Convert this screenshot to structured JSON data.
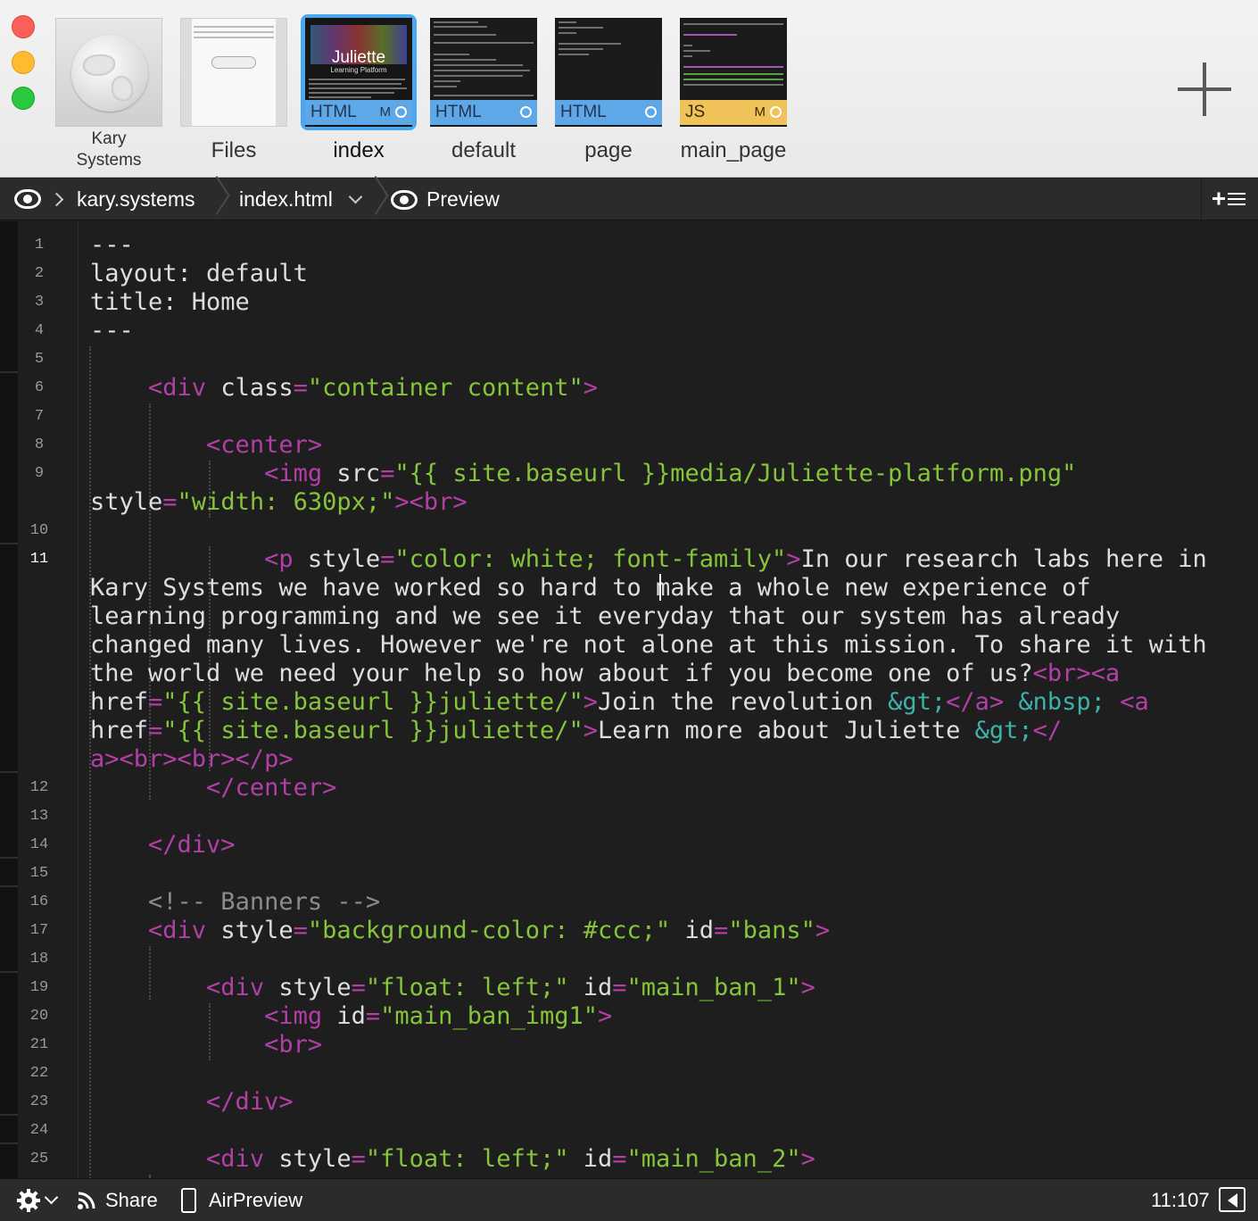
{
  "window": {
    "traffic_lights": [
      {
        "name": "close",
        "color": "#fc5f57"
      },
      {
        "name": "minimize",
        "color": "#fdbc2e"
      },
      {
        "name": "zoom",
        "color": "#29c83f"
      }
    ]
  },
  "tabs": [
    {
      "label_line1": "Kary",
      "label_line2": "Systems",
      "kind": "globe-icon"
    },
    {
      "label": "Files",
      "kind": "files-icon"
    },
    {
      "label": "index",
      "type": "HTML",
      "modified": "M",
      "active": true
    },
    {
      "label": "default",
      "type": "HTML",
      "modified": ""
    },
    {
      "label": "page",
      "type": "HTML",
      "modified": ""
    },
    {
      "label": "main_page",
      "type": "JS",
      "modified": "M"
    }
  ],
  "thumb": {
    "juliette_title": "Juliette",
    "juliette_sub": "Learning Platform"
  },
  "pathbar": {
    "site": "kary.systems",
    "file": "index.html",
    "preview": "Preview"
  },
  "editor": {
    "line_numbers": [
      "1",
      "2",
      "3",
      "4",
      "5",
      "6",
      "7",
      "8",
      "9",
      "10",
      "11",
      "12",
      "13",
      "14",
      "15",
      "16",
      "17",
      "18",
      "19",
      "20",
      "21",
      "22",
      "23",
      "24",
      "25"
    ],
    "current_line": "11"
  },
  "statusbar": {
    "share": "Share",
    "airpreview": "AirPreview",
    "cursor": "11:107"
  },
  "colors": {
    "tag": "#b23fa6",
    "string": "#86c43a",
    "entity": "#3bb3a8",
    "comment": "#8c8c8c",
    "text": "#dedede",
    "active_tab": "#4aa8f0"
  }
}
